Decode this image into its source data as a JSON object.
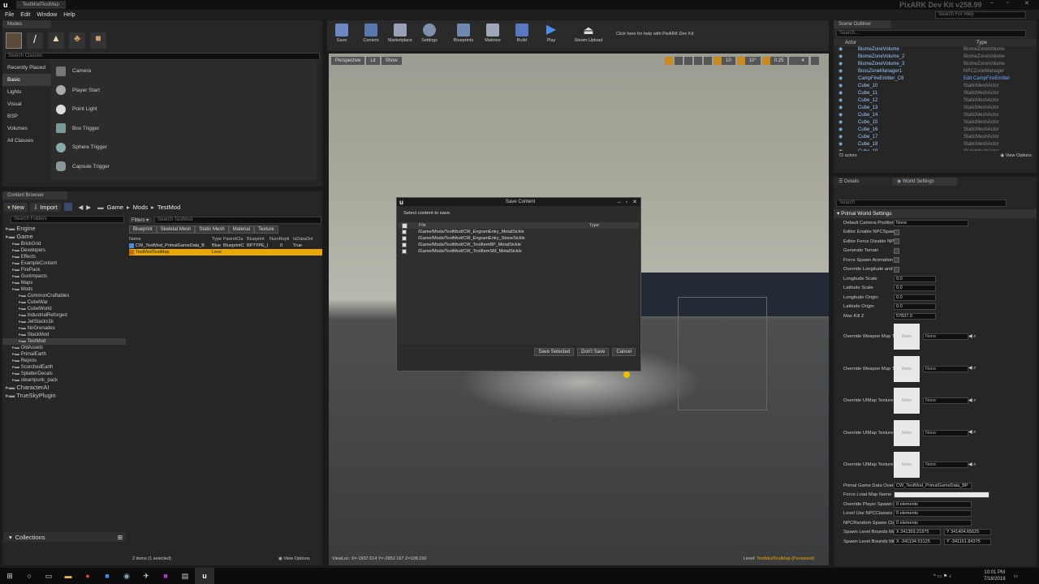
{
  "window": {
    "tab_title": "TestModTestMap",
    "app_title": "PixARK Dev Kit v258.99",
    "search_help_placeholder": "Search For Help"
  },
  "menu": [
    "File",
    "Edit",
    "Window",
    "Help"
  ],
  "modes": {
    "title": "Modes",
    "search_placeholder": "Search Classes",
    "categories": [
      "Recently Placed",
      "Basic",
      "Lights",
      "Visual",
      "BSP",
      "Volumes",
      "All Classes"
    ],
    "items": [
      "Camera",
      "Player Start",
      "Point Light",
      "Box Trigger",
      "Sphere Trigger",
      "Capsule Trigger"
    ]
  },
  "toolbar": {
    "buttons": [
      "Save",
      "Content",
      "Marketplace",
      "Settings",
      "Blueprints",
      "Matinee",
      "Build",
      "Play",
      "Steam Upload"
    ],
    "help_text": "Click here for help with PixARK Dev Kit"
  },
  "viewport": {
    "perspective": "Perspective",
    "lit": "Lit",
    "show": "Show",
    "grid": "10",
    "angle": "10°",
    "scale": "0.25",
    "cam": "4",
    "viewloc": "ViewLoc: X=-1937.614 Y=-2852.167 Z=108.150",
    "level_label": "Level:",
    "level_name": "TestModTestMap (Persistent)"
  },
  "content_browser": {
    "title": "Content Browser",
    "new_label": "New",
    "import_label": "Import",
    "breadcrumb": [
      "Game",
      "Mods",
      "TestMod"
    ],
    "search_folders": "Search Folders",
    "filters_label": "Filters",
    "search_label": "Search TestMod",
    "filter_tabs": [
      "Blueprint",
      "Skeletal Mesh",
      "Static Mesh",
      "Material",
      "Texture"
    ],
    "columns": [
      "Name",
      "Type",
      "ParentCla",
      "Blueprint",
      "NumRepli",
      "IsDataOnl"
    ],
    "rows": [
      {
        "name": "CW_TestMod_PrimalGameData_B",
        "type": "Blue",
        "parent": "BlueprintC",
        "bp": "BPTYPE_I",
        "num": "0",
        "data": "True"
      },
      {
        "name": "TestModTestMap",
        "type": "Leve",
        "parent": "",
        "bp": "",
        "num": "",
        "data": ""
      }
    ],
    "status": "2 items (1 selected)",
    "view_options": "View Options",
    "collections": "Collections",
    "tree": [
      {
        "label": "Engine",
        "d": 0,
        "big": true
      },
      {
        "label": "Game",
        "d": 0,
        "big": true
      },
      {
        "label": "BrickGrid",
        "d": 1
      },
      {
        "label": "Developers",
        "d": 1
      },
      {
        "label": "Effects",
        "d": 1
      },
      {
        "label": "ExampleContent",
        "d": 1
      },
      {
        "label": "FirePack",
        "d": 1
      },
      {
        "label": "GunImpacts",
        "d": 1
      },
      {
        "label": "Maps",
        "d": 1
      },
      {
        "label": "Mods",
        "d": 1
      },
      {
        "label": "CommonCraftables",
        "d": 2
      },
      {
        "label": "CubeWar",
        "d": 2
      },
      {
        "label": "CubeWorld",
        "d": 2
      },
      {
        "label": "IndustrialReforged",
        "d": 2
      },
      {
        "label": "JetStacks1k",
        "d": 2
      },
      {
        "label": "NoGrenades",
        "d": 2
      },
      {
        "label": "StackMod",
        "d": 2
      },
      {
        "label": "TestMod",
        "d": 2,
        "sel": true
      },
      {
        "label": "OldAssets",
        "d": 1
      },
      {
        "label": "PrimalEarth",
        "d": 1
      },
      {
        "label": "Repros",
        "d": 1
      },
      {
        "label": "ScorchedEarth",
        "d": 1
      },
      {
        "label": "SplatterDecals",
        "d": 1
      },
      {
        "label": "steampunk_pack",
        "d": 1
      },
      {
        "label": "CharacterAI",
        "d": 0,
        "big": true
      },
      {
        "label": "TrueSkyPlugin",
        "d": 0,
        "big": true
      }
    ]
  },
  "dialog": {
    "title": "Save Content",
    "prompt": "Select content to save.",
    "col_file": "File",
    "col_type": "Type",
    "files": [
      "/Game/Mods/TestMod/CW_EngramEntry_MetalSickle",
      "/Game/Mods/TestMod/CW_EngramEntry_StoneSickle",
      "/Game/Mods/TestMod/CW_ToolItemBP_MetalSickle",
      "/Game/Mods/TestMod/CW_ToolItemSM_MetalSickle"
    ],
    "save_selected": "Save Selected",
    "dont_save": "Don't Save",
    "cancel": "Cancel"
  },
  "outliner": {
    "title": "Scene Outliner",
    "search_placeholder": "Search...",
    "col_actor": "Actor",
    "col_type": "Type",
    "rows": [
      {
        "name": "BiomeZoneVolume",
        "type": "BiomeZoneVolume"
      },
      {
        "name": "BiomeZoneVolume_2",
        "type": "BiomeZoneVolume"
      },
      {
        "name": "BiomeZoneVolume_3",
        "type": "BiomeZoneVolume"
      },
      {
        "name": "BossZoneManager1",
        "type": "NPCZoneManager"
      },
      {
        "name": "CampFireEmitter_C6",
        "type": "Edit CampFireEmitter"
      },
      {
        "name": "Cube_10",
        "type": "StaticMeshActor"
      },
      {
        "name": "Cube_11",
        "type": "StaticMeshActor"
      },
      {
        "name": "Cube_12",
        "type": "StaticMeshActor"
      },
      {
        "name": "Cube_13",
        "type": "StaticMeshActor"
      },
      {
        "name": "Cube_14",
        "type": "StaticMeshActor"
      },
      {
        "name": "Cube_15",
        "type": "StaticMeshActor"
      },
      {
        "name": "Cube_16",
        "type": "StaticMeshActor"
      },
      {
        "name": "Cube_17",
        "type": "StaticMeshActor"
      },
      {
        "name": "Cube_18",
        "type": "StaticMeshActor"
      },
      {
        "name": "Cube_19",
        "type": "StaticMeshActor"
      }
    ],
    "count": "72 actors",
    "view_options": "View Options"
  },
  "details": {
    "tab_details": "Details",
    "tab_world": "World Settings",
    "search_placeholder": "Search",
    "section": "Primal World Settings",
    "bool_props": [
      {
        "label": "Default Camera Position Act",
        "value": "None"
      },
      {
        "label": "Editor Enable NPCSpawners"
      },
      {
        "label": "Editor Force Disable NPCSp"
      },
      {
        "label": "Generate Terrain"
      },
      {
        "label": "Force Spawn Animation Tes"
      },
      {
        "label": "Override Longitude and Latit"
      }
    ],
    "num_props": [
      {
        "label": "Longitude Scale",
        "value": "0.0"
      },
      {
        "label": "Latitude Scale",
        "value": "0.0"
      },
      {
        "label": "Longitude Origin",
        "value": "0.0"
      },
      {
        "label": "Latitude Origin",
        "value": "0.0"
      },
      {
        "label": "Max Kill Z",
        "value": "57837.0"
      }
    ],
    "tex_props": [
      {
        "label": "Override Weapon Map Textu",
        "value": "None"
      },
      {
        "label": "Override Weapon Map Textu",
        "value": "None"
      },
      {
        "label": "Override UIMap Texture Em",
        "value": "None"
      },
      {
        "label": "Override UIMap Texture Fille",
        "value": "None"
      },
      {
        "label": "Override UIMap Texture Sm",
        "value": "None"
      }
    ],
    "thumb_label": "None",
    "bottom_props": [
      {
        "label": "Primal Game Data Override",
        "value": "CW_TestMod_PrimalGameData_BP"
      },
      {
        "label": "Force Load Map Name",
        "value": ""
      },
      {
        "label": "Override Player Spawn Regi",
        "value": "0 elements"
      },
      {
        "label": "Level Use NPCClasses",
        "value": "0 elements"
      },
      {
        "label": "NPCRandom Spawn Class W",
        "value": "0 elements"
      },
      {
        "label": "Spawn Level Bounds Max",
        "value": "X 341359.21875",
        "value2": "Y 341404.65625"
      },
      {
        "label": "Spawn Level Bounds Min",
        "value": "X -341194.53125",
        "value2": "Y -341161.84375"
      }
    ]
  },
  "taskbar": {
    "time": "10:01 PM",
    "date": "7/18/2018"
  }
}
